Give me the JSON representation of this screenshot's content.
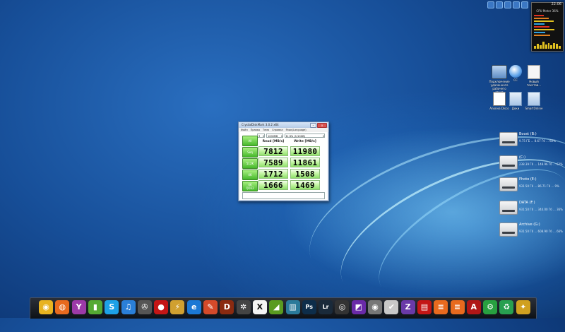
{
  "clock": "22:06",
  "gadget": {
    "title": "CPU Meter 36%",
    "bar_colors": [
      "#e03020",
      "#e08020",
      "#e0c020",
      "#30a0e0",
      "#e03020",
      "#e0c020",
      "#30a0e0",
      "#e08020"
    ]
  },
  "desktop_icons": [
    {
      "id": "network",
      "label": "Подключение\nудаленного\nрабочего\nстола"
    },
    {
      "id": "cc",
      "label": "CC"
    },
    {
      "id": "newdoc",
      "label": "Новый\nтекстов..."
    },
    {
      "id": "anon",
      "label": "Anonна Disco"
    },
    {
      "id": "docs",
      "label": "Доки"
    },
    {
      "id": "smart",
      "label": "SmartOnline"
    }
  ],
  "drives": [
    {
      "name": "Boost (B:)",
      "info": "9.75 ГБ ... 8.67 Гб ... 62%"
    },
    {
      "name": "(C:)",
      "info": "238.39 Гб ... 148.96 Гб ... 62%"
    },
    {
      "name": "Photo (E:)",
      "info": "931.50 Гб ... 86.71 Гб ... 9%"
    },
    {
      "name": "DATA (F:)",
      "info": "931.50 Гб ... 344.00 Гб ... 36%"
    },
    {
      "name": "Archive (G:)",
      "info": "931.50 Гб ... 608.90 Гб ... 66%"
    }
  ],
  "cdm": {
    "title": "CrystalDiskMark 3.0.2 x64",
    "menu": [
      "Файл",
      "Правка",
      "Тема",
      "Справка",
      "Язык(Language)"
    ],
    "count": "3",
    "size": "1000MB",
    "drive": "B: 8% (1/10GB)",
    "all_label": "All",
    "read_header": "Read [MB/s]",
    "write_header": "Write [MB/s]",
    "rows": [
      {
        "label": "Seq",
        "read": "7812",
        "write": "11980"
      },
      {
        "label": "512K",
        "read": "7589",
        "write": "11861"
      },
      {
        "label": "4K",
        "read": "1712",
        "write": "1508"
      },
      {
        "label": "4K\nQD32",
        "read": "1666",
        "write": "1469"
      }
    ]
  },
  "dock_items": [
    {
      "name": "chrome-icon",
      "glyph": "◉",
      "color": "#e8b320"
    },
    {
      "name": "firefox-icon",
      "glyph": "◍",
      "color": "#e86a1e"
    },
    {
      "name": "wine-icon",
      "glyph": "Y",
      "color": "#9c3aa8"
    },
    {
      "name": "drinks-icon",
      "glyph": "▮",
      "color": "#55aa33"
    },
    {
      "name": "skype-icon",
      "glyph": "S",
      "color": "#1da1e6"
    },
    {
      "name": "itunes-icon",
      "glyph": "♫",
      "color": "#2a7fd8"
    },
    {
      "name": "film-icon",
      "glyph": "✇",
      "color": "#555"
    },
    {
      "name": "record-icon",
      "glyph": "●",
      "color": "#c41616"
    },
    {
      "name": "winamp-icon",
      "glyph": "⚡",
      "color": "#d0a030"
    },
    {
      "name": "ie-icon",
      "glyph": "e",
      "color": "#1b78d4"
    },
    {
      "name": "paint-icon",
      "glyph": "✎",
      "color": "#d44a2a"
    },
    {
      "name": "diablo-icon",
      "glyph": "D",
      "color": "#8a2a10"
    },
    {
      "name": "spider-icon",
      "glyph": "✲",
      "color": "#444"
    },
    {
      "name": "x-icon",
      "glyph": "X",
      "color": "#f4f4f4"
    },
    {
      "name": "nvidia-icon",
      "glyph": "◢",
      "color": "#5a9b20"
    },
    {
      "name": "bridge-icon",
      "glyph": "▥",
      "color": "#2a7a9a"
    },
    {
      "name": "photoshop-icon",
      "glyph": "Ps",
      "color": "#0d2d4a"
    },
    {
      "name": "lightroom-icon",
      "glyph": "Lr",
      "color": "#1a2a3a"
    },
    {
      "name": "lens-icon",
      "glyph": "◎",
      "color": "#333"
    },
    {
      "name": "app-icon",
      "glyph": "◩",
      "color": "#6a2aa8"
    },
    {
      "name": "daemon-icon",
      "glyph": "◉",
      "color": "#777"
    },
    {
      "name": "check-icon",
      "glyph": "✔",
      "color": "#c8c8c8"
    },
    {
      "name": "cpuz-icon",
      "glyph": "Z",
      "color": "#6a3aa8"
    },
    {
      "name": "burn-icon",
      "glyph": "▤",
      "color": "#c41616"
    },
    {
      "name": "menu1-icon",
      "glyph": "≡",
      "color": "#e86a1e"
    },
    {
      "name": "menu2-icon",
      "glyph": "≡",
      "color": "#e86a1e"
    },
    {
      "name": "aida-icon",
      "glyph": "A",
      "color": "#b01616"
    },
    {
      "name": "tool-icon",
      "glyph": "⚙",
      "color": "#28a040"
    },
    {
      "name": "recycle-icon",
      "glyph": "♻",
      "color": "#28a050"
    },
    {
      "name": "wand-icon",
      "glyph": "✦",
      "color": "#d0a020"
    }
  ]
}
